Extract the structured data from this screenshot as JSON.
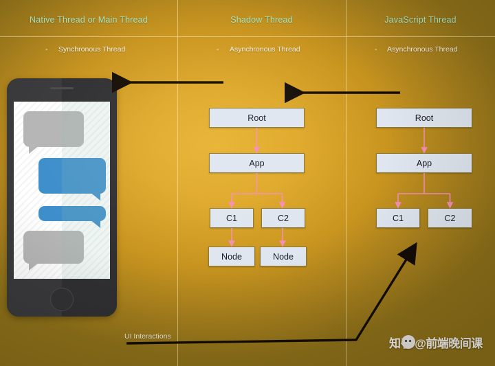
{
  "slide": {
    "background_color": "#dfa828",
    "accent_title_color": "#a9e7c2",
    "text_color": "#f6f0e2",
    "box_fill": "#dfe6ef",
    "box_border": "#8a7a3a",
    "tree_link_color": "#f48fb1",
    "arrow_color": "#140d06"
  },
  "columns": [
    {
      "id": "native",
      "title": "Native Thread or Main Thread",
      "bullet_dash": "-",
      "subtitle": "Synchronous Thread"
    },
    {
      "id": "shadow",
      "title": "Shadow Thread",
      "bullet_dash": "-",
      "subtitle": "Asynchronous Thread"
    },
    {
      "id": "javascript",
      "title": "JavaScript Thread",
      "bullet_dash": "-",
      "subtitle": "Asynchronous Thread"
    }
  ],
  "phone": {
    "name": "mobile-device-mockup",
    "bubbles": [
      {
        "side": "left",
        "color": "#b5b5b5",
        "label": "incoming-message-bubble-1"
      },
      {
        "side": "right",
        "color": "#3d8ecb",
        "label": "outgoing-message-bubble-1"
      },
      {
        "side": "right",
        "color": "#3d8ecb",
        "label": "outgoing-message-bubble-2"
      },
      {
        "side": "left",
        "color": "#b5b5b5",
        "label": "incoming-message-bubble-2"
      }
    ]
  },
  "shadow_tree": {
    "root": "Root",
    "app": "App",
    "children": [
      "C1",
      "C2"
    ],
    "leaves": [
      "Node",
      "Node"
    ]
  },
  "js_tree": {
    "root": "Root",
    "app": "App",
    "children": [
      "C1",
      "C2"
    ]
  },
  "annotations": {
    "ui_interactions": "UI Interactions",
    "arrow_shadow_to_native": "arrow-shadow-to-native",
    "arrow_js_to_shadow": "arrow-js-to-shadow",
    "arrow_ui_to_js": "arrow-ui-interactions-to-js"
  },
  "watermark": {
    "text": "知乎 @前端晚间课",
    "icon": "wechat-face-icon"
  }
}
